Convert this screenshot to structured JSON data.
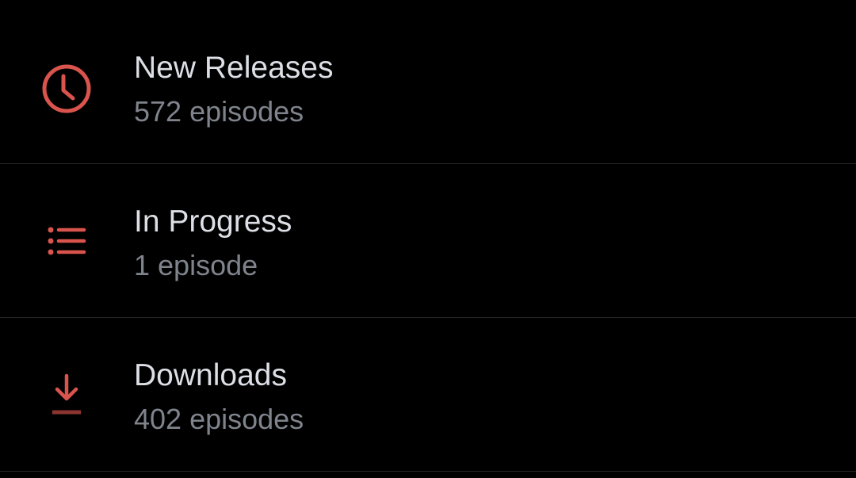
{
  "accent_color": "#d9544d",
  "list": {
    "items": [
      {
        "icon": "clock-icon",
        "title": "New Releases",
        "subtitle": "572 episodes"
      },
      {
        "icon": "list-icon",
        "title": "In Progress",
        "subtitle": "1 episode"
      },
      {
        "icon": "download-icon",
        "title": "Downloads",
        "subtitle": "402 episodes"
      }
    ]
  }
}
